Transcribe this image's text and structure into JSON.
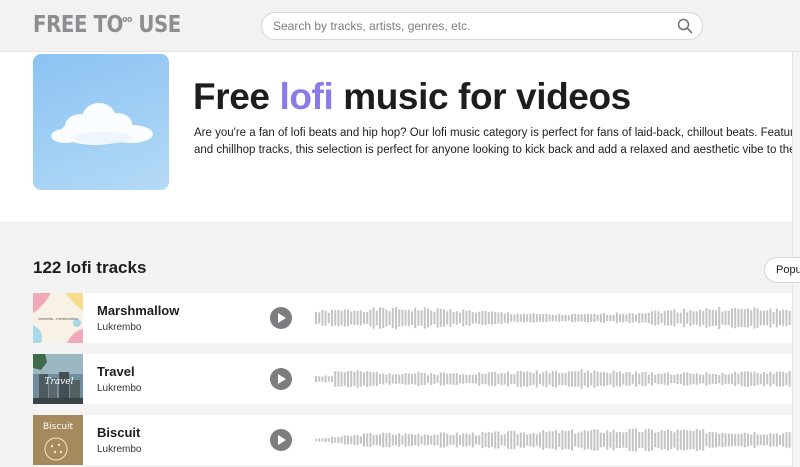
{
  "header": {
    "logo_text": "FREE TO",
    "logo_sup": "oo",
    "logo_tail": " USE",
    "search_placeholder": "Search by tracks, artists, genres, etc."
  },
  "hero": {
    "title_pre": "Free ",
    "title_accent": "lofi",
    "title_post": " music for videos",
    "description_line1": "Are you're a fan of lofi beats and hip hop? Our lofi music category is perfect for fans of laid-back, chillout beats. Featurin",
    "description_line2": "and chillhop tracks, this selection is perfect for anyone looking to kick back and add a relaxed and aesthetic vibe to their"
  },
  "tracks_section": {
    "heading": "122 lofi tracks",
    "sort_label": "Popu"
  },
  "tracks": [
    {
      "title": "Marshmallow",
      "artist": "Lukrembo",
      "thumb_text": "lukrembo - marshmallow"
    },
    {
      "title": "Travel",
      "artist": "Lukrembo",
      "thumb_text": "Travel"
    },
    {
      "title": "Biscuit",
      "artist": "Lukrembo",
      "thumb_text": "Biscuit"
    }
  ],
  "colors": {
    "accent": "#8b7be8",
    "waveform": "#c4c4c6",
    "play_button": "#7d7d80"
  }
}
